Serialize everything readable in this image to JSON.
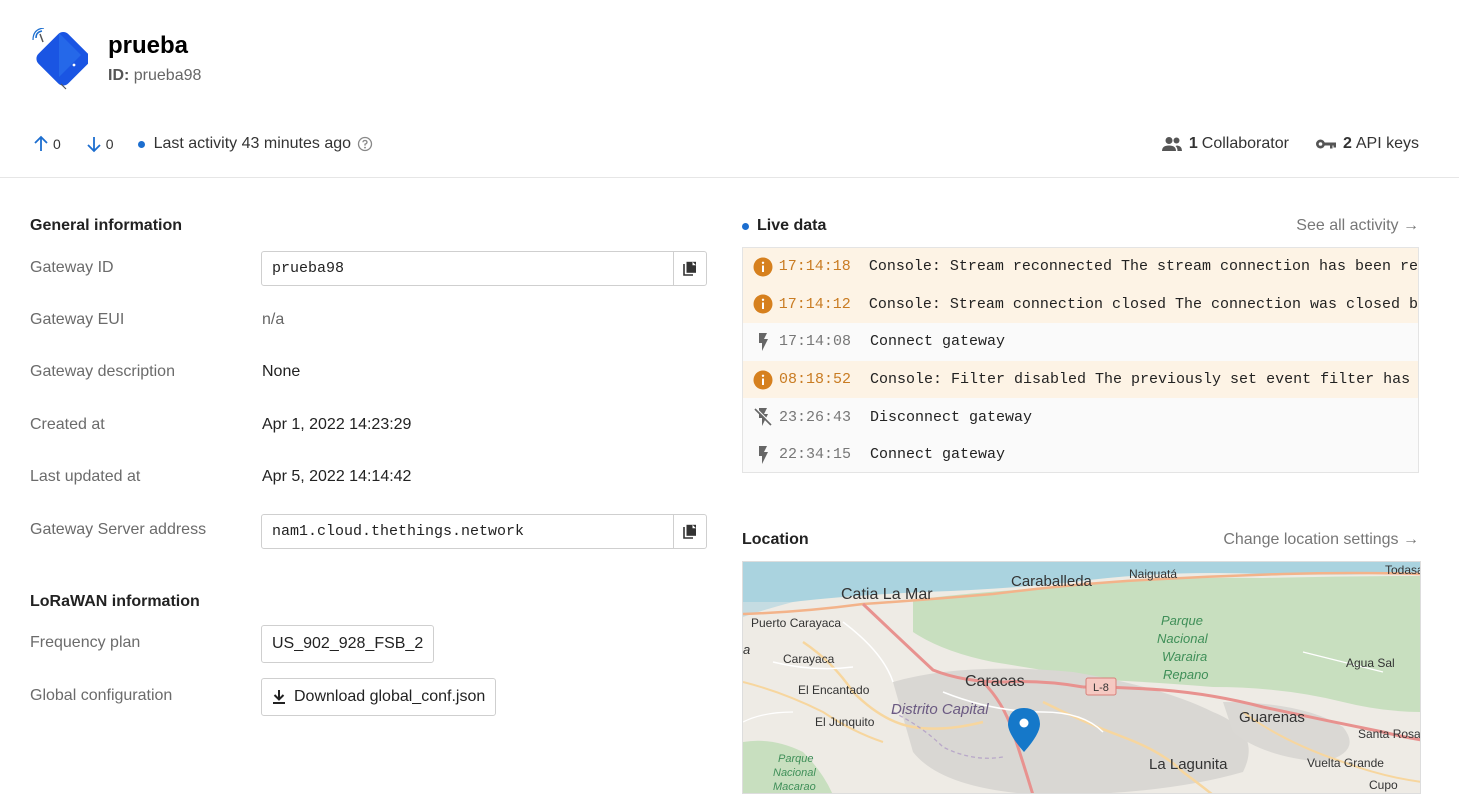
{
  "header": {
    "title": "prueba",
    "id_label": "ID:",
    "id_value": "prueba98"
  },
  "stats": {
    "uplink_count": "0",
    "downlink_count": "0",
    "last_activity": "Last activity 43 minutes ago",
    "collaborators_count": "1",
    "collaborators_label": "Collaborator",
    "api_keys_count": "2",
    "api_keys_label": "API keys"
  },
  "general": {
    "title": "General information",
    "rows": [
      {
        "label": "Gateway ID",
        "value": "prueba98"
      },
      {
        "label": "Gateway EUI",
        "value": "n/a"
      },
      {
        "label": "Gateway description",
        "value": "None"
      },
      {
        "label": "Created at",
        "value": "Apr 1, 2022 14:23:29"
      },
      {
        "label": "Last updated at",
        "value": "Apr 5, 2022 14:14:42"
      },
      {
        "label": "Gateway Server address",
        "value": "nam1.cloud.thethings.network"
      }
    ]
  },
  "lorawan": {
    "title": "LoRaWAN information",
    "frequency_plan_label": "Frequency plan",
    "frequency_plan_value": "US_902_928_FSB_2",
    "global_config_label": "Global configuration",
    "download_button": "Download global_conf.json"
  },
  "live_data": {
    "title": "Live data",
    "see_all": "See all activity →",
    "events": [
      {
        "kind": "warn",
        "icon": "info-icon",
        "time": "17:14:18",
        "message": "Console: Stream reconnected  The stream connection has been re"
      },
      {
        "kind": "warn",
        "icon": "info-icon",
        "time": "17:14:12",
        "message": "Console: Stream connection closed  The connection was closed b"
      },
      {
        "kind": "normal",
        "icon": "bolt-icon",
        "time": "17:14:08",
        "message": "Connect gateway"
      },
      {
        "kind": "warn",
        "icon": "info-icon",
        "time": "08:18:52",
        "message": "Console: Filter disabled  The previously set event filter has"
      },
      {
        "kind": "normal",
        "icon": "bolt-off-icon",
        "time": "23:26:43",
        "message": "Disconnect gateway"
      },
      {
        "kind": "normal",
        "icon": "bolt-icon",
        "time": "22:34:15",
        "message": "Connect gateway"
      }
    ]
  },
  "location": {
    "title": "Location",
    "change_link": "Change location settings →",
    "map_labels": {
      "catia": "Catia La Mar",
      "caraballeda": "Caraballeda",
      "naiguata": "Naiguatá",
      "todasana": "Todasa",
      "puerto": "Puerto Carayaca",
      "carayaca": "Carayaca",
      "a": "a",
      "parque1": "Parque",
      "parque2": "Nacional",
      "parque3": "Waraira",
      "parque4": "Repano",
      "aguasal": "Agua Sal",
      "caracas": "Caracas",
      "l8": "L-8",
      "encantado": "El Encantado",
      "distrito": "Distrito Capital",
      "guarenas": "Guarenas",
      "junquito": "El Junquito",
      "santarosa": "Santa Rosa",
      "parquem1": "Parque",
      "parquem2": "Nacional",
      "parquem3": "Macarao",
      "lagunita": "La Lagunita",
      "vuelta": "Vuelta Grande",
      "cupo": "Cupo"
    }
  }
}
